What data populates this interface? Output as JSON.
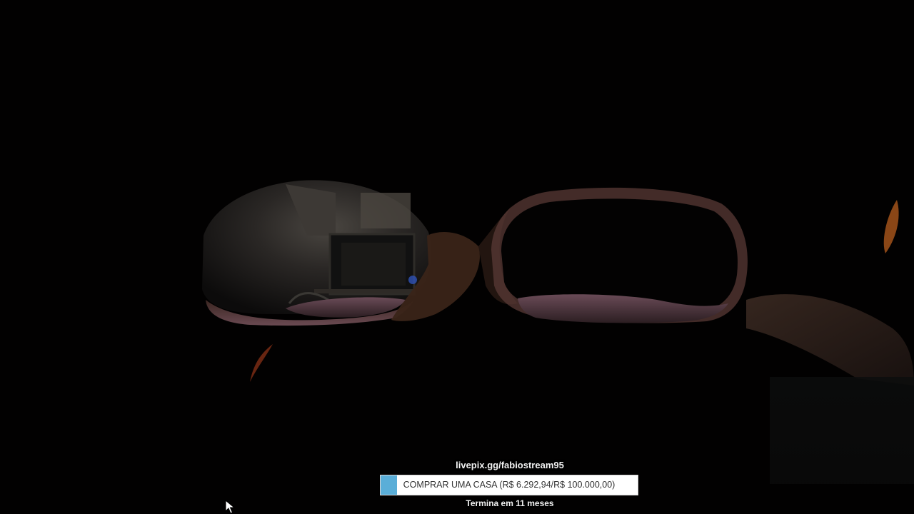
{
  "overlay": {
    "link": "livepix.gg/fabiostream95",
    "goal": {
      "label": "COMPRAR UMA CASA (R$ 6.292,94/R$ 100.000,00)",
      "current": 6292.94,
      "target": 100000.0,
      "fill_color": "#5aaed8"
    },
    "ends": "Termina em 11 meses"
  },
  "icons": {
    "cursor": "mouse-pointer-icon"
  }
}
